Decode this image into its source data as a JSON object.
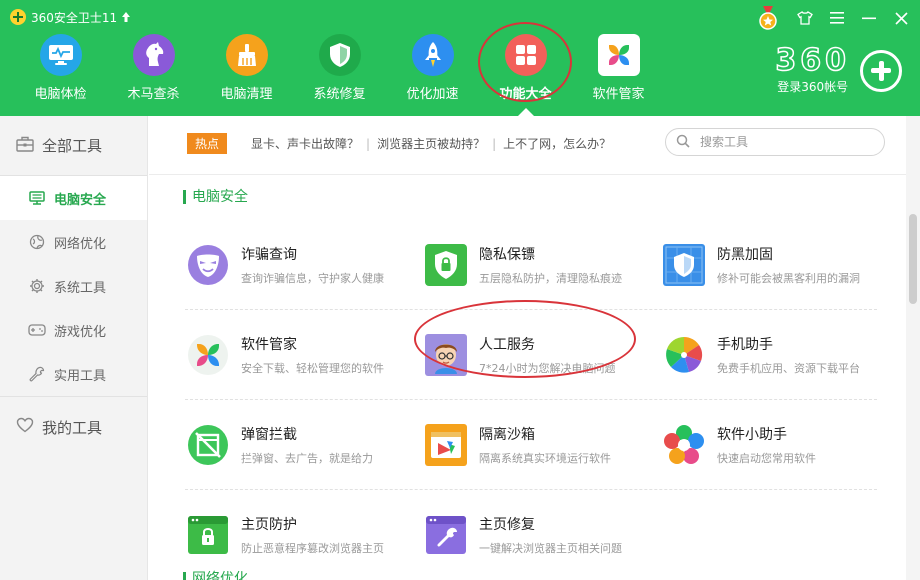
{
  "window": {
    "title": "360安全卫士11"
  },
  "nav": {
    "items": [
      {
        "label": "电脑体检",
        "icon": "monitor-check-icon",
        "color": "#25a6e8"
      },
      {
        "label": "木马查杀",
        "icon": "horse-icon",
        "color": "#8a5ad8"
      },
      {
        "label": "电脑清理",
        "icon": "broom-icon",
        "color": "#f5a21c"
      },
      {
        "label": "系统修复",
        "icon": "shield-check-icon",
        "color": "#1faa4b"
      },
      {
        "label": "优化加速",
        "icon": "rocket-icon",
        "color": "#2d8ff0"
      },
      {
        "label": "功能大全",
        "icon": "grid-icon",
        "color": "#f2605a",
        "active": true
      },
      {
        "label": "软件管家",
        "icon": "software-icon",
        "color": "#ffffff"
      }
    ]
  },
  "brand": {
    "logo": "360",
    "login": "登录360帐号"
  },
  "sidebar": {
    "all_tools": "全部工具",
    "items": [
      {
        "label": "电脑安全",
        "icon": "monitor-icon",
        "active": true
      },
      {
        "label": "网络优化",
        "icon": "globe-icon"
      },
      {
        "label": "系统工具",
        "icon": "gear-icon"
      },
      {
        "label": "游戏优化",
        "icon": "gamepad-icon"
      },
      {
        "label": "实用工具",
        "icon": "wrench-icon"
      }
    ],
    "my_tools": "我的工具"
  },
  "hot": {
    "badge": "热点",
    "links": [
      "显卡、声卡出故障？",
      "浏览器主页被劫持？",
      "上不了网，怎么办？"
    ]
  },
  "search": {
    "placeholder": "搜索工具"
  },
  "section": {
    "title": "电脑安全",
    "next_title": "网络优化"
  },
  "tools": [
    [
      {
        "name": "诈骗查询",
        "desc": "查询诈骗信息，守护家人健康",
        "icon": "mask-icon"
      },
      {
        "name": "隐私保镖",
        "desc": "五层隐私防护，清理隐私痕迹",
        "icon": "privacy-shield-icon"
      },
      {
        "name": "防黑加固",
        "desc": "修补可能会被黑客利用的漏洞",
        "icon": "anti-hack-shield-icon"
      }
    ],
    [
      {
        "name": "软件管家",
        "desc": "安全下载、轻松管理您的软件",
        "icon": "software-manager-icon"
      },
      {
        "name": "人工服务",
        "desc": "7*24小时为您解决电脑问题",
        "icon": "human-service-icon"
      },
      {
        "name": "手机助手",
        "desc": "免费手机应用、资源下载平台",
        "icon": "phone-assistant-icon"
      }
    ],
    [
      {
        "name": "弹窗拦截",
        "desc": "拦弹窗、去广告，就是给力",
        "icon": "popup-block-icon"
      },
      {
        "name": "隔离沙箱",
        "desc": "隔离系统真实环境运行软件",
        "icon": "sandbox-icon"
      },
      {
        "name": "软件小助手",
        "desc": "快速启动您常用软件",
        "icon": "software-helper-icon"
      }
    ],
    [
      {
        "name": "主页防护",
        "desc": "防止恶意程序篡改浏览器主页",
        "icon": "homepage-lock-icon"
      },
      {
        "name": "主页修复",
        "desc": "一键解决浏览器主页相关问题",
        "icon": "homepage-repair-icon"
      }
    ]
  ]
}
